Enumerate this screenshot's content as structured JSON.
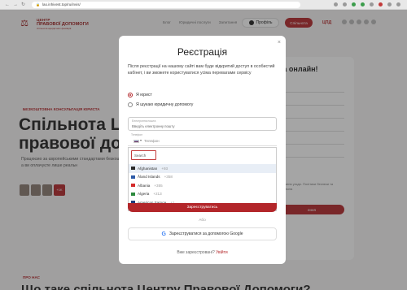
{
  "browser": {
    "url": "lao.inhivest.top/ru/invis/"
  },
  "header": {
    "logo": {
      "l1": "ЦЕНТР",
      "l2": "ПРАВОВОЇ ДОПОМОГИ",
      "l3": "спільнота юридичних фахівців"
    },
    "nav": [
      "Блог",
      "Юридичні послуги",
      "Запитання"
    ],
    "profile_label": "Профіль",
    "consult_label": "Спільнота",
    "upd_label": "ЦПД"
  },
  "hero": {
    "tag": "БЕЗКОШТОВНА КОНСУЛЬТАЦІЯ ЮРИСТА",
    "title_line1": "Спільнота Цен",
    "title_line2": "правової допо",
    "desc": "Працюємо за європейськими стандартами безкоштовно, а ви оплачуєте лише реальн",
    "badge": "+1K"
  },
  "side": {
    "title": "та онлайн!",
    "text": "надання угоди. Політики безпеки та Правила",
    "button": "ення"
  },
  "about": {
    "tag": "ПРО НАС",
    "title": "Що таке спільнота Центру Правової Допомоги?"
  },
  "modal": {
    "title": "Реєстрація",
    "close": "×",
    "desc": "Після реєстрації на нашому сайті вам буде відкритий доступ в особистий кабінет, і ви зможете користуватися усіма перевагами сервісу",
    "radio_lawyer": "Я юрист",
    "radio_seek": "Я шукаю юридичну допомогу",
    "email_label": "Електронна пошта",
    "email_placeholder": "Введіть електронну пошту",
    "phone_label": "Телефон",
    "phone_placeholder": "Телефон",
    "search_value": "Search",
    "countries": [
      {
        "name": "Afghanistan",
        "code": "+93",
        "flag": "#2a2a2a"
      },
      {
        "name": "Åland Islands",
        "code": "+358",
        "flag": "#2b5aa8"
      },
      {
        "name": "Albania",
        "code": "+355",
        "flag": "#d42a2a"
      },
      {
        "name": "Algeria",
        "code": "+213",
        "flag": "#2c8a3e"
      },
      {
        "name": "American Samoa",
        "code": "+1",
        "flag": "#1f3b7a"
      }
    ],
    "register_label": "Зареєструватись",
    "or_label": "Або",
    "google_label": "Зареєструватися за допомогою Google",
    "login_prompt": "Вже зареєстровані?",
    "login_link": "Увійти"
  }
}
